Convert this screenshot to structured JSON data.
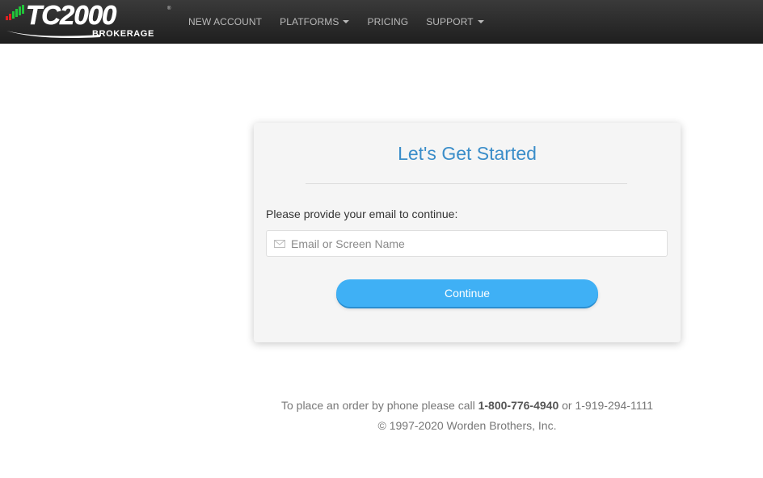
{
  "brand": {
    "name": "TC2000",
    "subtitle": "BROKERAGE",
    "reg_mark": "®",
    "colors": {
      "bar_red": "#e02020",
      "bar_green": "#22c33a",
      "nav_bg": "#2b2b2b",
      "accent_blue": "#3a8dc9",
      "button_blue": "#3fb0f5"
    }
  },
  "nav": {
    "items": [
      {
        "label": "NEW ACCOUNT",
        "dropdown": false
      },
      {
        "label": "PLATFORMS",
        "dropdown": true
      },
      {
        "label": "PRICING",
        "dropdown": false
      },
      {
        "label": "SUPPORT",
        "dropdown": true
      }
    ]
  },
  "card": {
    "title": "Let's Get Started",
    "prompt": "Please provide your email to continue:",
    "email": {
      "placeholder": "Email or Screen Name",
      "value": "",
      "icon": "envelope-icon"
    },
    "continue_label": "Continue"
  },
  "footer": {
    "phone_prefix": "To place an order by phone please call ",
    "phone_primary": "1-800-776-4940",
    "phone_mid": " or ",
    "phone_secondary": "1-919-294-1111",
    "copyright": "© 1997-2020 Worden Brothers, Inc."
  }
}
